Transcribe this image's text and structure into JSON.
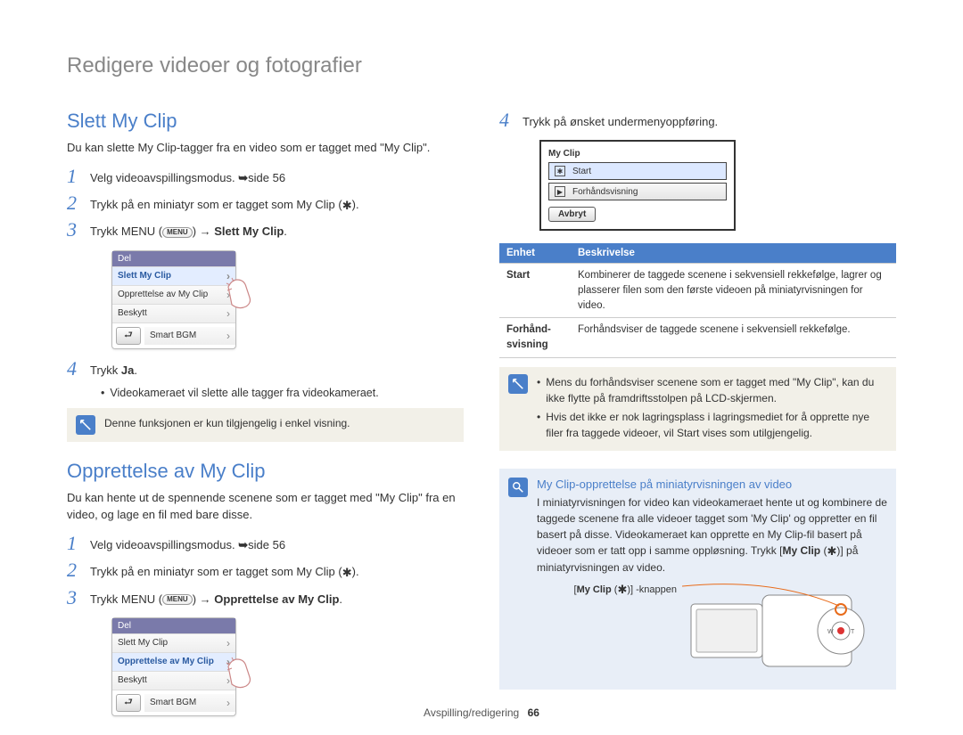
{
  "page_title": "Redigere videoer og fotografier",
  "left": {
    "slett": {
      "title": "Slett My Clip",
      "intro": "Du kan slette My Clip-tagger fra en video som er tagget med \"My Clip\".",
      "steps": [
        {
          "num": "1",
          "html": "Velg videoavspillingsmodus. <span class='ref-arrow'>➥</span>side 56"
        },
        {
          "num": "2",
          "html": "Trykk på en miniatyr som er tagget som My Clip (<span class='tag-icon'>✱</span>)."
        },
        {
          "num": "3",
          "html": "Trykk MENU (<span class='pill'>MENU</span>) <span class='arrow'>→</span> <span class='bold'>Slett My Clip</span>."
        }
      ],
      "step4": {
        "num": "4",
        "html": "Trykk <span class='bold'>Ja</span>."
      },
      "bullet4": "Videokameraet vil slette alle tagger fra videokameraet.",
      "note": "Denne funksjonen er kun tilgjengelig i enkel visning.",
      "menu": {
        "header": "Del",
        "items": [
          "Slett My Clip",
          "Opprettelse av My Clip",
          "Beskytt",
          "Smart BGM"
        ],
        "highlight_index": 0
      }
    },
    "opprett": {
      "title": "Opprettelse av My Clip",
      "intro": "Du kan hente ut de spennende scenene som er tagget med \"My Clip\" fra en video, og lage en fil med bare disse.",
      "steps": [
        {
          "num": "1",
          "html": "Velg videoavspillingsmodus. <span class='ref-arrow'>➥</span>side 56"
        },
        {
          "num": "2",
          "html": "Trykk på en miniatyr som er tagget som My Clip (<span class='tag-icon'>✱</span>)."
        },
        {
          "num": "3",
          "html": "Trykk MENU (<span class='pill'>MENU</span>) <span class='arrow'>→</span> <span class='bold'>Opprettelse av My Clip</span>."
        }
      ],
      "menu": {
        "header": "Del",
        "items": [
          "Slett My Clip",
          "Opprettelse av My Clip",
          "Beskytt",
          "Smart BGM"
        ],
        "highlight_index": 1
      }
    }
  },
  "right": {
    "step4": {
      "num": "4",
      "text": "Trykk på ønsket undermenyoppføring."
    },
    "screen": {
      "title": "My Clip",
      "row1": "Start",
      "row2": "Forhåndsvisning",
      "btn": "Avbryt"
    },
    "table": {
      "h1": "Enhet",
      "h2": "Beskrivelse",
      "rows": [
        {
          "k": "Start",
          "v": "Kombinerer de taggede scenene i sekvensiell rekkefølge, lagrer og plasserer filen som den første videoen på miniatyrvisningen for video."
        },
        {
          "k": "Forhånd­svisning",
          "v": "Forhåndsviser de taggede scenene i sekvensiell rekkefølge."
        }
      ]
    },
    "note_items": [
      "Mens du forhåndsviser scenene som er tagget med \"My Clip\", kan du ikke flytte på framdriftsstolpen på LCD-skjermen.",
      "Hvis det ikke er nok lagringsplass i lagringsmediet for å opprette nye filer fra taggede videoer, vil Start vises som utilgjengelig."
    ],
    "info": {
      "title": "My Clip-opprettelse på miniatyrvisningen av video",
      "body_html": "I miniatyrvisningen for video kan videokameraet hente ut og kombinere de taggede scenene fra alle videoer tagget som 'My Clip' og oppretter en fil basert på disse. Videokameraet kan opprette en My Clip-fil basert på videoer som er tatt opp i samme oppløsning. Trykk [<span class='bold'>My Clip</span> (<span class='tag-icon'>✱</span>)] på miniatyrvisningen av video.",
      "btn_label_html": "[<span class='bold'>My Clip</span> (<span class='tag-icon'>✱</span>)] -knappen"
    }
  },
  "footer": {
    "section": "Avspilling/redigering",
    "page": "66"
  }
}
